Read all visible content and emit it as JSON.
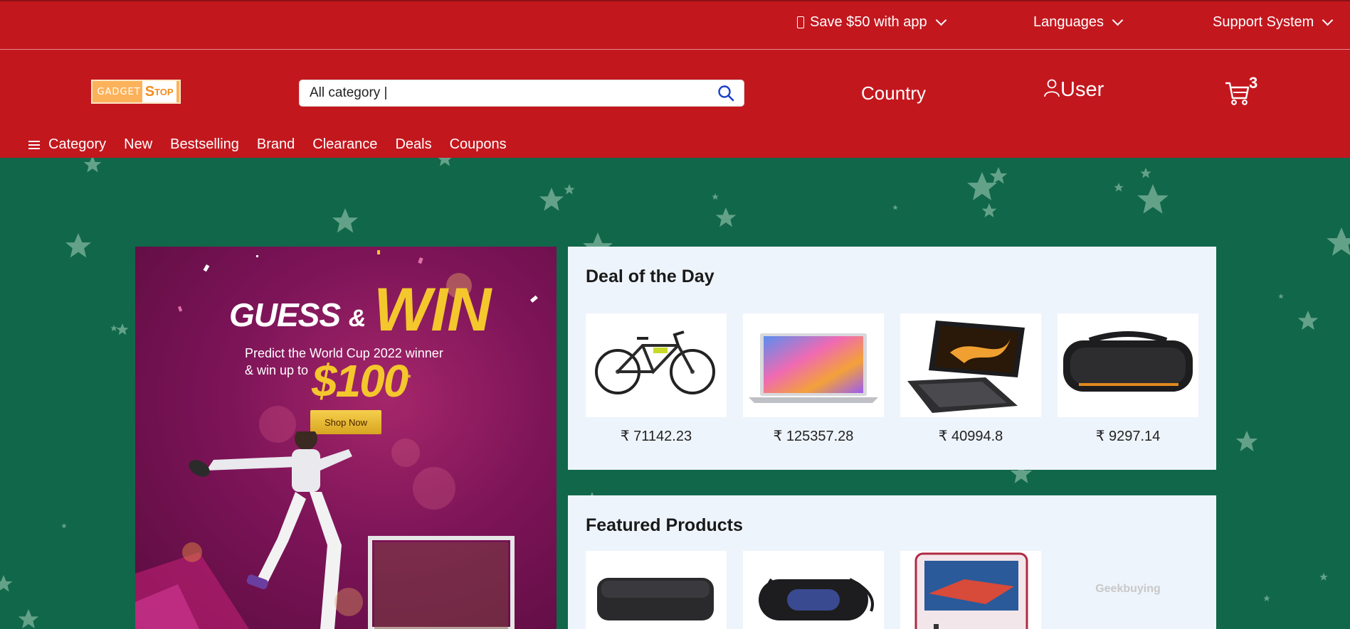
{
  "topbar": {
    "app_promo": "Save $50 with app",
    "languages": "Languages",
    "support": "Support System"
  },
  "header": {
    "logo_part1": "GADGET",
    "logo_part2_initial": "S",
    "logo_part2_rest": "TOP",
    "search_value": "All category |",
    "country": "Country",
    "user": "User",
    "cart_count": "3"
  },
  "nav": {
    "category": "Category",
    "items": [
      "New",
      "Bestselling",
      "Brand",
      "Clearance",
      "Deals",
      "Coupons"
    ]
  },
  "banner": {
    "title_part1": "GUESS",
    "title_amp": "&",
    "title_part2": "WIN",
    "subtitle_line1": "Predict the World Cup 2022 winner",
    "subtitle_line2": "& win up to",
    "amount": "$100",
    "amount_mark": "*",
    "cta": "Shop Now"
  },
  "deal": {
    "title": "Deal of the Day",
    "products": [
      {
        "icon": "bicycle-image",
        "price": "₹ 71142.23"
      },
      {
        "icon": "laptop-image",
        "price": "₹ 125357.28"
      },
      {
        "icon": "mini-laptop-image",
        "price": "₹ 40994.8"
      },
      {
        "icon": "speaker-image",
        "price": "₹ 9297.14"
      }
    ]
  },
  "featured": {
    "title": "Featured Products",
    "products": [
      {
        "icon": "bluetooth-speaker-image"
      },
      {
        "icon": "portable-speaker-image"
      },
      {
        "icon": "handheld-console-image"
      },
      {
        "icon": "placeholder-logo",
        "placeholder_text": "Geekbuying"
      }
    ]
  },
  "colors": {
    "header_red": "#c3171e",
    "background_green": "#11674a",
    "panel_bg": "#eef4fc",
    "accent_gold": "#f4c72d"
  }
}
